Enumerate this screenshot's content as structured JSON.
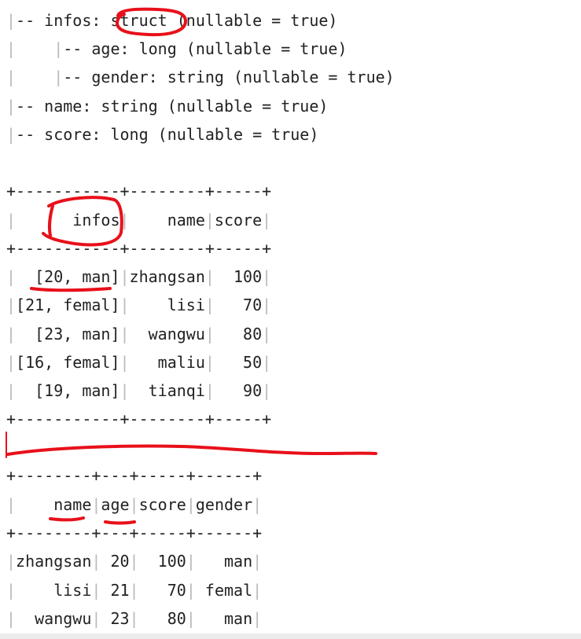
{
  "schema": {
    "lines": [
      "|-- infos: struct (nullable = true)",
      "|    |-- age: long (nullable = true)",
      "|    |-- gender: string (nullable = true)",
      "|-- name: string (nullable = true)",
      "|-- score: long (nullable = true)"
    ]
  },
  "table1": {
    "lines": [
      "+-----------+--------+-----+",
      "|      infos|    name|score|",
      "+-----------+--------+-----+",
      "|  [20, man]|zhangsan|  100|",
      "|[21, femal]|    lisi|   70|",
      "|  [23, man]|  wangwu|   80|",
      "|[16, femal]|   maliu|   50|",
      "|  [19, man]|  tianqi|   90|",
      "+-----------+--------+-----+"
    ]
  },
  "table2": {
    "lines": [
      "+--------+---+-----+------+",
      "|    name|age|score|gender|",
      "+--------+---+-----+------+",
      "|zhangsan| 20|  100|   man|",
      "|    lisi| 21|   70| femal|",
      "|  wangwu| 23|   80|   man|"
    ]
  },
  "annotation_color": "#e8101a"
}
